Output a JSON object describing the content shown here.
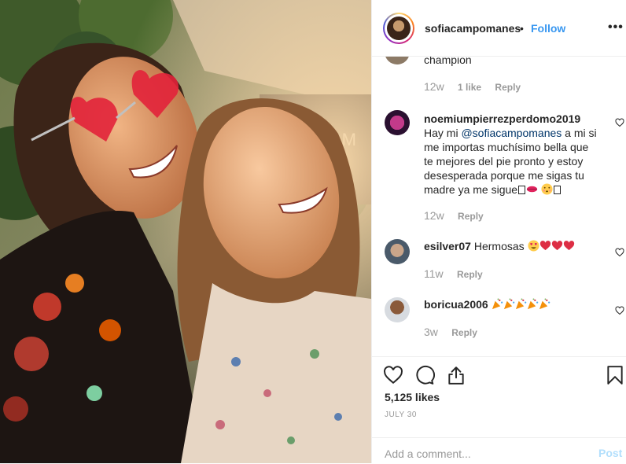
{
  "post": {
    "username": "sofiacampomanes",
    "separator": "•",
    "follow_label": "Follow",
    "more_label": "•••",
    "photo_text": "AM"
  },
  "comments": [
    {
      "text": "champion",
      "time": "12w",
      "likes": "1 like",
      "reply": "Reply"
    },
    {
      "username": "noemiumpierrezperdomo2019",
      "text_before": "Hay mi",
      "mention": "@sofiacampomanes",
      "text_after": " a mi si me importas muchísimo bella que te mejores del pie pronto y estoy desesperada porque me sigas tu madre ya me sigue",
      "emoji": [
        "kiss-mark-emoji",
        "kissing-face-emoji"
      ],
      "time": "12w",
      "reply": "Reply"
    },
    {
      "username": "esilver07",
      "text": "Hermosas",
      "emoji": [
        "heart-eyes-emoji",
        "red-heart-emoji",
        "red-heart-emoji",
        "red-heart-emoji"
      ],
      "time": "11w",
      "reply": "Reply"
    },
    {
      "username": "boricua2006",
      "emoji": [
        "party-popper-emoji",
        "party-popper-emoji",
        "party-popper-emoji",
        "party-popper-emoji",
        "party-popper-emoji"
      ],
      "time": "3w",
      "reply": "Reply"
    }
  ],
  "actions": {
    "likes": "5,125 likes",
    "date": "JULY 30",
    "icons": [
      "heart-icon",
      "comment-icon",
      "share-icon",
      "bookmark-icon"
    ]
  },
  "add_comment": {
    "placeholder": "Add a comment...",
    "post_label": "Post"
  },
  "colors": {
    "link": "#3897f0",
    "mention": "#003569",
    "muted": "#999999",
    "post_disabled": "#b2dffc",
    "heart_red": "#ed4956"
  }
}
